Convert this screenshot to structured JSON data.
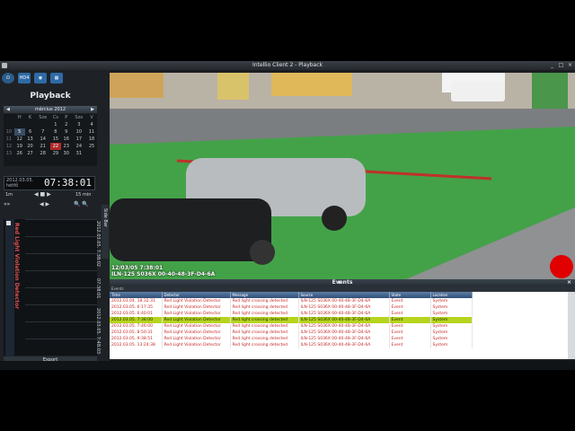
{
  "window": {
    "title": "Intellio Client 2 - Playback"
  },
  "toolbar": {
    "btn2": "HD4",
    "minimize": "_",
    "maximize": "□",
    "close": "×"
  },
  "playback": {
    "title": "Playback",
    "month": "március 2012",
    "weekdays": [
      "H",
      "K",
      "Sze",
      "Cs",
      "P",
      "Szo",
      "V"
    ],
    "weeks": [
      {
        "wk": "",
        "days": [
          "",
          "",
          "",
          "1",
          "2",
          "3",
          "4"
        ]
      },
      {
        "wk": "10",
        "days": [
          "5",
          "6",
          "7",
          "8",
          "9",
          "10",
          "11"
        ]
      },
      {
        "wk": "11",
        "days": [
          "12",
          "13",
          "14",
          "15",
          "16",
          "17",
          "18"
        ]
      },
      {
        "wk": "12",
        "days": [
          "19",
          "20",
          "21",
          "22",
          "23",
          "24",
          "25"
        ]
      },
      {
        "wk": "13",
        "days": [
          "26",
          "27",
          "28",
          "29",
          "30",
          "31",
          ""
        ]
      }
    ],
    "date_line1": "2012.03.05.",
    "date_line2": "hétfő",
    "time": "07:38:01",
    "speed_left": "1m",
    "speed_right": "15 min",
    "export": "Export"
  },
  "timeline": {
    "label": "Red Light Violation Detector",
    "time_a": "2012.03.05. 7:38:02",
    "time_b": "07:38:01",
    "time_c": "2012.03.05. 7:48:03"
  },
  "sidebar_tab": "Side Bar",
  "video": {
    "timestamp": "12/03/05 7:38:01",
    "camera": "ILN-125 S036X 00-40-48-3F-D4-6A"
  },
  "events": {
    "title": "Events",
    "subtitle": "Events",
    "columns": [
      "Time",
      "Detector",
      "Message",
      "Source",
      "State",
      "Location"
    ],
    "rows": [
      [
        "2012.03.04. 18:32:31",
        "Red Light Violation Detector",
        "Red light crossing detected",
        "ILN-125 S036X 00-40-48-3F-D4-6A",
        "Event",
        "System"
      ],
      [
        "2012.03.05. 6:17:35",
        "Red Light Violation Detector",
        "Red light crossing detected",
        "ILN-125 S036X 00-40-48-3F-D4-6A",
        "Event",
        "System"
      ],
      [
        "2012.03.05. 6:40:01",
        "Red Light Violation Detector",
        "Red light crossing detected",
        "ILN-125 S036X 00-40-48-3F-D4-6A",
        "Event",
        "System"
      ],
      [
        "2012.03.05. 7:38:00",
        "Red Light Violation Detector",
        "Red light crossing detected",
        "ILN-125 S036X 00-40-48-3F-D4-6A",
        "Event",
        "System"
      ],
      [
        "2012.03.05. 7:46:00",
        "Red Light Violation Detector",
        "Red light crossing detected",
        "ILN-125 S036X 00-40-48-3F-D4-6A",
        "Event",
        "System"
      ],
      [
        "2012.03.05. 8:50:31",
        "Red Light Violation Detector",
        "Red light crossing detected",
        "ILN-125 S036X 00-40-48-3F-D4-6A",
        "Event",
        "System"
      ],
      [
        "2012.03.05. 9:38:51",
        "Red Light Violation Detector",
        "Red light crossing detected",
        "ILN-125 S036X 00-40-48-3F-D4-6A",
        "Event",
        "System"
      ],
      [
        "2012.03.05. 13:24:38",
        "Red Light Violation Detector",
        "Red light crossing detected",
        "ILN-125 S036X 00-40-48-3F-D4-6A",
        "Event",
        "System"
      ]
    ],
    "highlighted_row": 3
  },
  "colors": {
    "accent": "#2f4e76",
    "highlight": "#b6d41e",
    "event_text": "#c62828",
    "zone": "#3fd24a",
    "rec": "#e00000"
  }
}
